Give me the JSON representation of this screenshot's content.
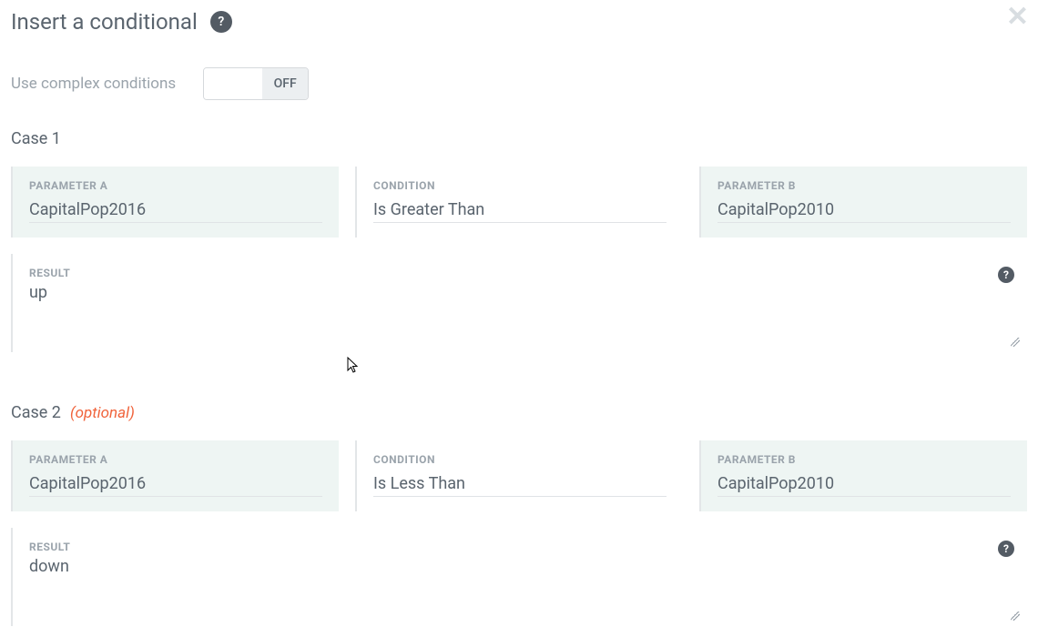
{
  "header": {
    "title": "Insert a conditional"
  },
  "toggle": {
    "label": "Use complex conditions",
    "value": "OFF"
  },
  "labels": {
    "paramA": "PARAMETER A",
    "condition": "CONDITION",
    "paramB": "PARAMETER B",
    "result": "RESULT"
  },
  "case1": {
    "heading": "Case 1",
    "paramA": "CapitalPop2016",
    "condition": "Is Greater Than",
    "paramB": "CapitalPop2010",
    "result": "up"
  },
  "case2": {
    "heading": "Case 2",
    "optional": "(optional)",
    "paramA": "CapitalPop2016",
    "condition": "Is Less Than",
    "paramB": "CapitalPop2010",
    "result": "down"
  }
}
